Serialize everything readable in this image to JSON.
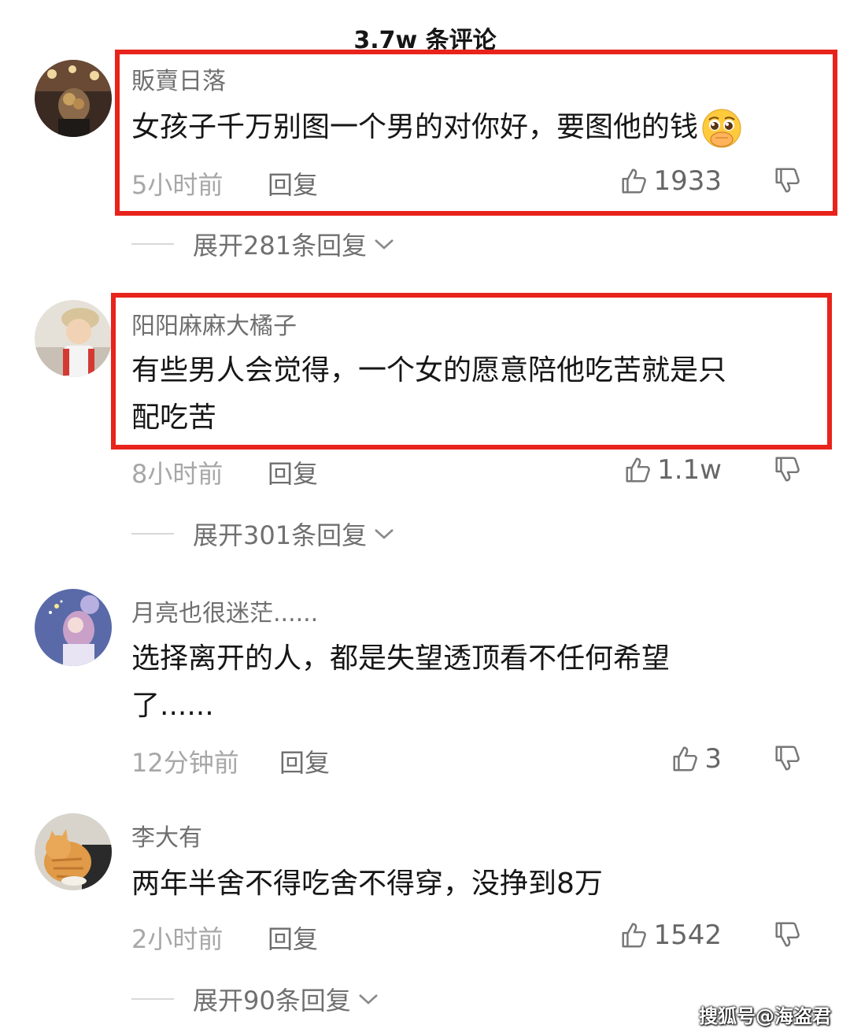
{
  "header": {
    "title": "3.7w 条评论"
  },
  "comments": [
    {
      "username": "販賣日落",
      "content": "女孩子千万别图一个男的对你好，要图他的钱",
      "time": "5小时前",
      "reply_label": "回复",
      "likes": "1933",
      "expand_label": "展开281条回复",
      "highlighted": true,
      "emoji": "pleading-face-covering-mouth-icon"
    },
    {
      "username": "阳阳麻麻大橘子",
      "content_lines": [
        "有些男人会觉得，一个女的愿意陪他吃苦就是只",
        "配吃苦"
      ],
      "time": "8小时前",
      "reply_label": "回复",
      "likes": "1.1w",
      "expand_label": "展开301条回复",
      "highlighted": true
    },
    {
      "username": "月亮也很迷茫......",
      "content_lines": [
        "选择离开的人，都是失望透顶看不任何希望",
        "了......"
      ],
      "time": "12分钟前",
      "reply_label": "回复",
      "likes": "3"
    },
    {
      "username": "李大有",
      "content": "两年半舍不得吃舍不得穿，没挣到8万",
      "time": "2小时前",
      "reply_label": "回复",
      "likes": "1542",
      "expand_label": "展开90条回复"
    }
  ],
  "watermark": "搜狐号@海盗君",
  "colors": {
    "highlight": "#e8231c",
    "muted": "#a7a7a7"
  }
}
